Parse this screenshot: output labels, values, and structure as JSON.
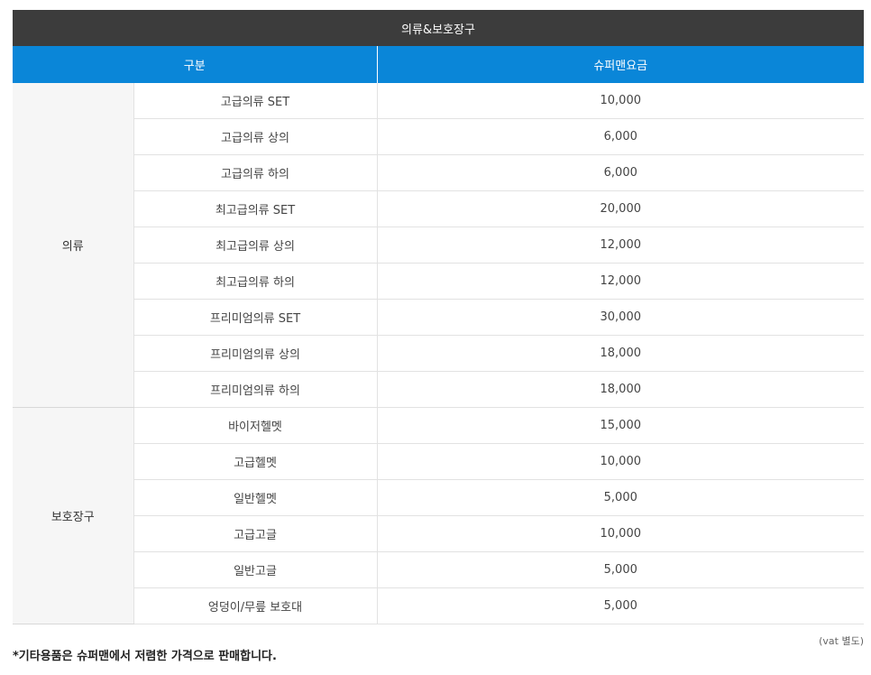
{
  "table": {
    "title": "의류&보호장구",
    "col_category": "구분",
    "col_price": "슈퍼맨요금",
    "groups": [
      {
        "name": "의류",
        "rows": [
          {
            "item": "고급의류 SET",
            "price": "10,000"
          },
          {
            "item": "고급의류 상의",
            "price": "6,000"
          },
          {
            "item": "고급의류 하의",
            "price": "6,000"
          },
          {
            "item": "최고급의류 SET",
            "price": "20,000"
          },
          {
            "item": "최고급의류 상의",
            "price": "12,000"
          },
          {
            "item": "최고급의류 하의",
            "price": "12,000"
          },
          {
            "item": "프리미엄의류 SET",
            "price": "30,000"
          },
          {
            "item": "프리미엄의류 상의",
            "price": "18,000"
          },
          {
            "item": "프리미엄의류 하의",
            "price": "18,000"
          }
        ]
      },
      {
        "name": "보호장구",
        "rows": [
          {
            "item": "바이저헬멧",
            "price": "15,000"
          },
          {
            "item": "고급헬멧",
            "price": "10,000"
          },
          {
            "item": "일반헬멧",
            "price": "5,000"
          },
          {
            "item": "고급고글",
            "price": "10,000"
          },
          {
            "item": "일반고글",
            "price": "5,000"
          },
          {
            "item": "엉덩이/무릎 보호대",
            "price": "5,000"
          }
        ]
      }
    ]
  },
  "footer": {
    "vat_note": "(vat 별도)",
    "notice": "*기타용품은 슈퍼맨에서 저렴한 가격으로 판매합니다."
  }
}
